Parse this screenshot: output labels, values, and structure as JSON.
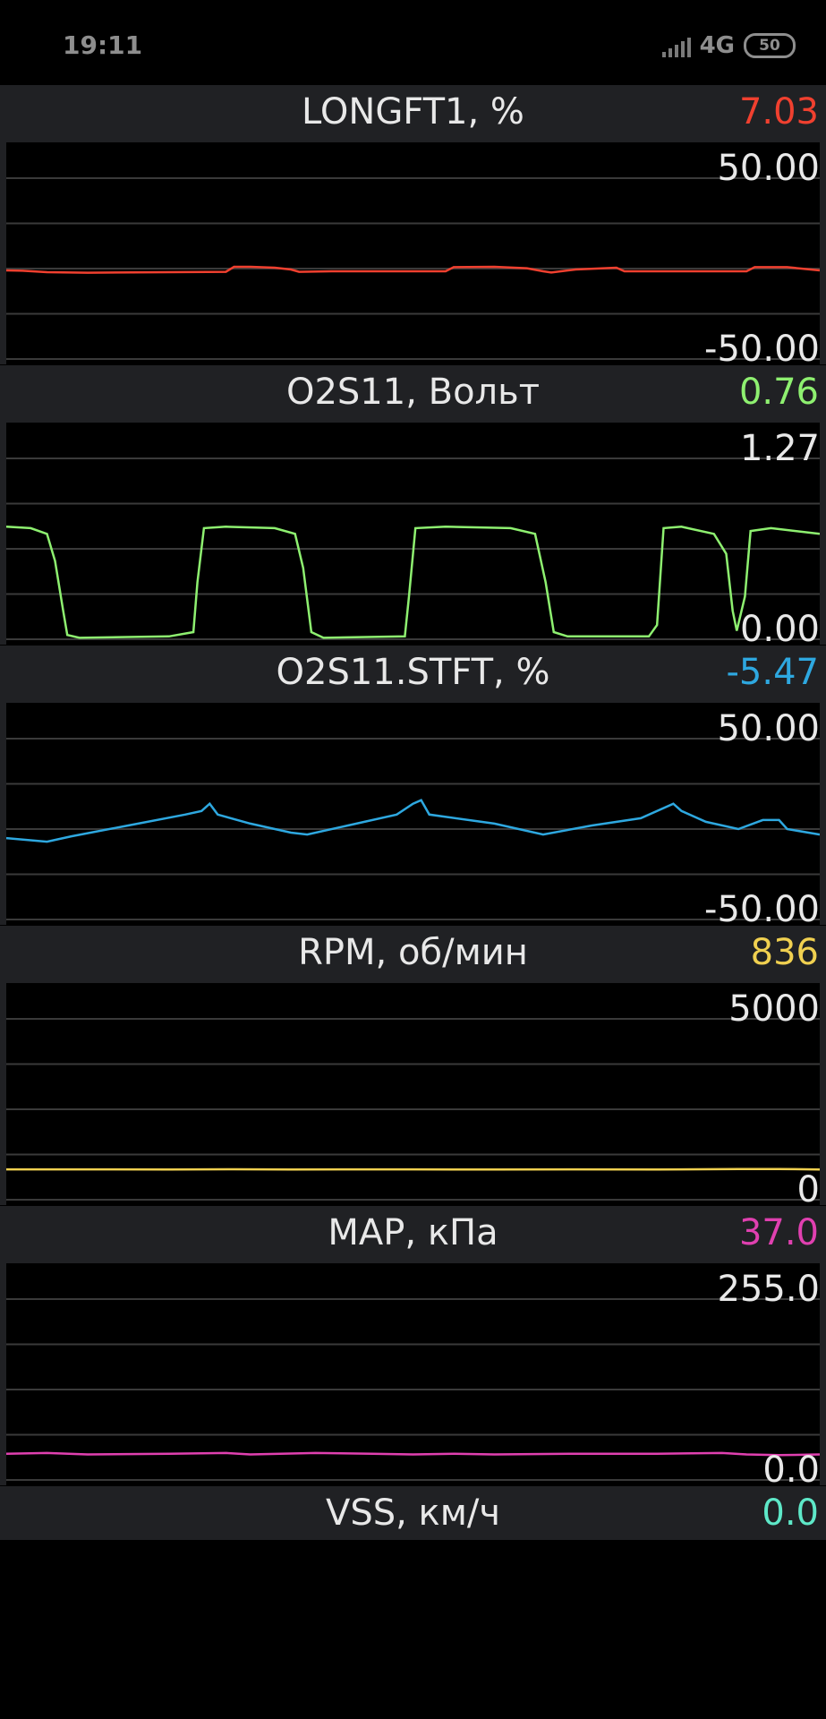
{
  "status_bar": {
    "time": "19:11",
    "network": "4G",
    "battery": "50"
  },
  "panels": [
    {
      "title": "LONGFT1, %",
      "value": "7.03",
      "color": "#f0402f",
      "max": "50.00",
      "min": "-50.00",
      "series": [
        [
          0,
          -1
        ],
        [
          2,
          -1.2
        ],
        [
          5,
          -2
        ],
        [
          10,
          -2.3
        ],
        [
          20,
          -2
        ],
        [
          27,
          -1.8
        ],
        [
          28,
          1
        ],
        [
          30,
          1
        ],
        [
          33,
          0.5
        ],
        [
          35,
          -0.5
        ],
        [
          36,
          -1.8
        ],
        [
          40,
          -1.5
        ],
        [
          54,
          -1.5
        ],
        [
          55,
          0.8
        ],
        [
          60,
          1
        ],
        [
          64,
          0.2
        ],
        [
          66,
          -1.5
        ],
        [
          67,
          -2.2
        ],
        [
          70,
          -0.5
        ],
        [
          75,
          0.5
        ],
        [
          76,
          -1.5
        ],
        [
          91,
          -1.5
        ],
        [
          92,
          0.8
        ],
        [
          96,
          0.8
        ],
        [
          100,
          -1
        ]
      ]
    },
    {
      "title": "O2S11, Вольт",
      "value": "0.76",
      "color": "#8ef070",
      "max": "1.27",
      "min": "0.00",
      "series": [
        [
          0,
          0.79
        ],
        [
          3,
          0.78
        ],
        [
          5,
          0.74
        ],
        [
          6,
          0.55
        ],
        [
          7,
          0.2
        ],
        [
          7.5,
          0.03
        ],
        [
          9,
          0.01
        ],
        [
          20,
          0.02
        ],
        [
          23,
          0.05
        ],
        [
          23.5,
          0.4
        ],
        [
          24.3,
          0.78
        ],
        [
          27,
          0.79
        ],
        [
          33,
          0.78
        ],
        [
          35.5,
          0.74
        ],
        [
          36.5,
          0.5
        ],
        [
          37.5,
          0.05
        ],
        [
          39,
          0.01
        ],
        [
          49,
          0.02
        ],
        [
          49.5,
          0.3
        ],
        [
          50.3,
          0.78
        ],
        [
          54,
          0.79
        ],
        [
          62,
          0.78
        ],
        [
          65,
          0.74
        ],
        [
          66.3,
          0.4
        ],
        [
          67.3,
          0.05
        ],
        [
          69,
          0.02
        ],
        [
          79,
          0.02
        ],
        [
          80,
          0.1
        ],
        [
          80.8,
          0.78
        ],
        [
          83,
          0.79
        ],
        [
          87,
          0.74
        ],
        [
          88.5,
          0.6
        ],
        [
          89.3,
          0.2
        ],
        [
          89.8,
          0.06
        ],
        [
          90.8,
          0.3
        ],
        [
          91.5,
          0.76
        ],
        [
          94,
          0.78
        ],
        [
          100,
          0.74
        ]
      ]
    },
    {
      "title": "O2S11.STFT, %",
      "value": "-5.47",
      "color": "#2ea8e0",
      "max": "50.00",
      "min": "-50.00",
      "series": [
        [
          0,
          -5
        ],
        [
          5,
          -7
        ],
        [
          8,
          -4
        ],
        [
          15,
          2
        ],
        [
          22,
          8
        ],
        [
          24,
          10
        ],
        [
          25,
          14
        ],
        [
          26,
          8
        ],
        [
          30,
          3
        ],
        [
          35,
          -2
        ],
        [
          37,
          -3
        ],
        [
          42,
          2
        ],
        [
          48,
          8
        ],
        [
          50,
          14
        ],
        [
          51,
          16
        ],
        [
          52,
          8
        ],
        [
          60,
          3
        ],
        [
          66,
          -3
        ],
        [
          72,
          2
        ],
        [
          78,
          6
        ],
        [
          82,
          14
        ],
        [
          83,
          10
        ],
        [
          86,
          4
        ],
        [
          90,
          0
        ],
        [
          93,
          5
        ],
        [
          95,
          5
        ],
        [
          96,
          0
        ],
        [
          100,
          -3
        ]
      ]
    },
    {
      "title": "RPM, об/мин",
      "value": "836",
      "color": "#f0d050",
      "max": "5000",
      "min": "0",
      "series": [
        [
          0,
          840
        ],
        [
          10,
          838
        ],
        [
          20,
          836
        ],
        [
          28,
          842
        ],
        [
          35,
          836
        ],
        [
          50,
          838
        ],
        [
          60,
          834
        ],
        [
          70,
          840
        ],
        [
          80,
          836
        ],
        [
          90,
          846
        ],
        [
          95,
          850
        ],
        [
          100,
          836
        ]
      ]
    },
    {
      "title": "MAP, кПа",
      "value": "37.0",
      "color": "#e040b0",
      "max": "255.0",
      "min": "0.0",
      "series": [
        [
          0,
          37
        ],
        [
          5,
          38
        ],
        [
          10,
          36
        ],
        [
          20,
          37
        ],
        [
          27,
          38
        ],
        [
          30,
          36
        ],
        [
          38,
          38
        ],
        [
          45,
          37
        ],
        [
          50,
          36
        ],
        [
          55,
          37
        ],
        [
          60,
          36
        ],
        [
          70,
          37
        ],
        [
          80,
          37
        ],
        [
          88,
          38
        ],
        [
          91,
          36
        ],
        [
          95,
          35
        ],
        [
          100,
          36
        ]
      ]
    },
    {
      "title": "VSS, км/ч",
      "value": "0.0",
      "color": "#5ee8c8",
      "max": "",
      "min": "",
      "series": []
    }
  ]
}
